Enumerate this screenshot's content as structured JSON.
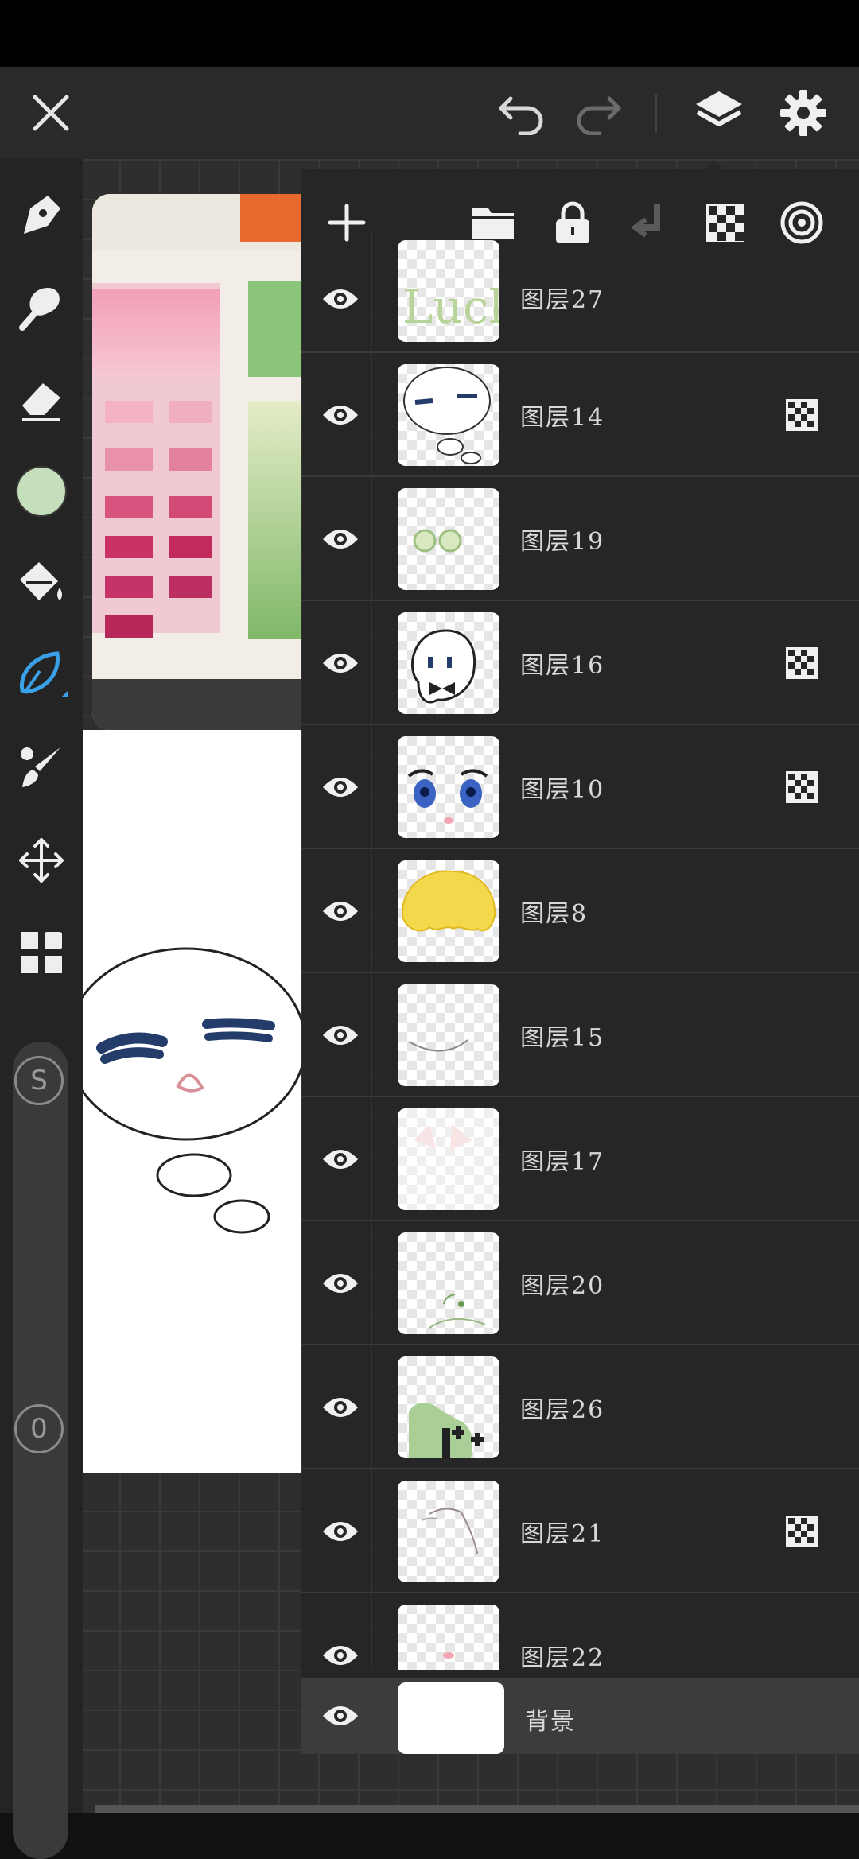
{
  "topbar": {
    "close_icon": "close-icon",
    "undo_icon": "undo-icon",
    "redo_icon": "redo-icon",
    "layers_icon": "layers-icon",
    "settings_icon": "gear-icon"
  },
  "tools": [
    {
      "name": "pen-tool",
      "icon": "pen-nib-icon"
    },
    {
      "name": "smudge-tool",
      "icon": "smudge-icon"
    },
    {
      "name": "eraser-tool",
      "icon": "eraser-icon"
    },
    {
      "name": "color-swatch",
      "icon": "color-circle",
      "color": "#c5dfbd"
    },
    {
      "name": "fill-tool",
      "icon": "paint-bucket-icon"
    },
    {
      "name": "lasso-tool",
      "icon": "lasso-icon",
      "active": true
    },
    {
      "name": "brush-tool",
      "icon": "brush-icon"
    },
    {
      "name": "transform-tool",
      "icon": "move-arrows-icon"
    },
    {
      "name": "gallery-tool",
      "icon": "grid-icon"
    }
  ],
  "sliders": {
    "size_label": "S",
    "opacity_label": "0"
  },
  "colors": {
    "accent": "#3aa0e8",
    "panel_bg": "#262626",
    "current_color": "#c5dfbd"
  },
  "layers_panel": {
    "header_icons": [
      "add-icon",
      "folder-icon",
      "lock-icon",
      "merge-down-icon",
      "alpha-lock-icon",
      "target-icon"
    ],
    "layers": [
      {
        "name": "图层27",
        "thumb": "luck-text",
        "alpha_lock": false
      },
      {
        "name": "图层14",
        "thumb": "sleepy-face",
        "alpha_lock": true
      },
      {
        "name": "图层19",
        "thumb": "glasses",
        "alpha_lock": false
      },
      {
        "name": "图层16",
        "thumb": "ghost",
        "alpha_lock": true
      },
      {
        "name": "图层10",
        "thumb": "eyes",
        "alpha_lock": true
      },
      {
        "name": "图层8",
        "thumb": "hair",
        "alpha_lock": false
      },
      {
        "name": "图层15",
        "thumb": "line",
        "alpha_lock": false
      },
      {
        "name": "图层17",
        "thumb": "pink-shapes",
        "alpha_lock": false
      },
      {
        "name": "图层20",
        "thumb": "sprout",
        "alpha_lock": false
      },
      {
        "name": "图层26",
        "thumb": "green-blob",
        "alpha_lock": false
      },
      {
        "name": "图层21",
        "thumb": "strands",
        "alpha_lock": true
      },
      {
        "name": "图层22",
        "thumb": "pink-dot",
        "alpha_lock": false
      }
    ],
    "background_label": "背景"
  }
}
